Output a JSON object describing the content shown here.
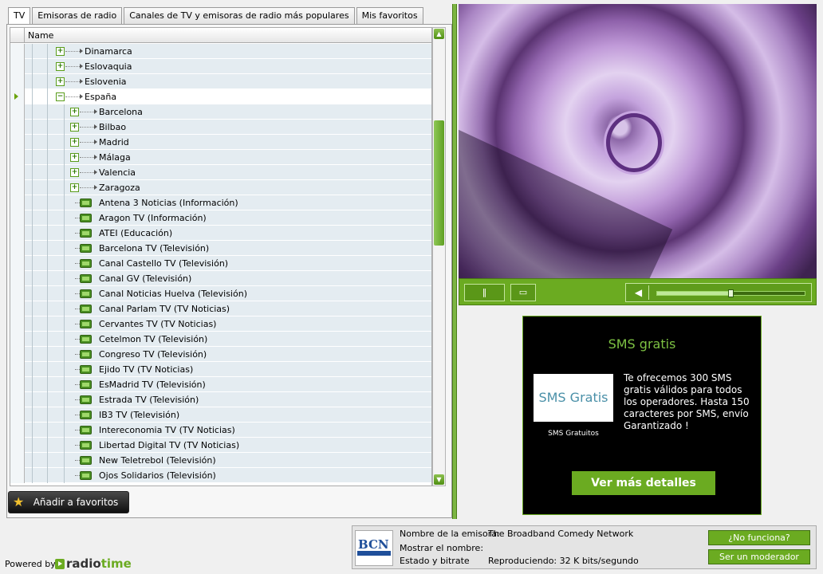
{
  "tabs": [
    {
      "label": "TV",
      "active": true
    },
    {
      "label": "Emisoras de radio",
      "active": false
    },
    {
      "label": "Canales de TV y emisoras de radio más populares",
      "active": false
    },
    {
      "label": "Mis favoritos",
      "active": false
    }
  ],
  "tree": {
    "column_header": "Name",
    "rows": [
      {
        "label": "Dinamarca",
        "level": 1,
        "type": "folder",
        "expanded": false
      },
      {
        "label": "Eslovaquia",
        "level": 1,
        "type": "folder",
        "expanded": false
      },
      {
        "label": "Eslovenia",
        "level": 1,
        "type": "folder",
        "expanded": false
      },
      {
        "label": "España",
        "level": 1,
        "type": "folder",
        "expanded": true,
        "selected": true
      },
      {
        "label": "Barcelona",
        "level": 2,
        "type": "folder",
        "expanded": false
      },
      {
        "label": "Bilbao",
        "level": 2,
        "type": "folder",
        "expanded": false
      },
      {
        "label": "Madrid",
        "level": 2,
        "type": "folder",
        "expanded": false
      },
      {
        "label": "Málaga",
        "level": 2,
        "type": "folder",
        "expanded": false
      },
      {
        "label": "Valencia",
        "level": 2,
        "type": "folder",
        "expanded": false
      },
      {
        "label": "Zaragoza",
        "level": 2,
        "type": "folder",
        "expanded": false
      },
      {
        "label": "Antena 3 Noticias (Información)",
        "level": 2,
        "type": "channel"
      },
      {
        "label": "Aragon TV (Información)",
        "level": 2,
        "type": "channel"
      },
      {
        "label": "ATEI (Educación)",
        "level": 2,
        "type": "channel"
      },
      {
        "label": "Barcelona TV (Televisión)",
        "level": 2,
        "type": "channel"
      },
      {
        "label": "Canal Castello TV (Televisión)",
        "level": 2,
        "type": "channel"
      },
      {
        "label": "Canal GV (Televisión)",
        "level": 2,
        "type": "channel"
      },
      {
        "label": "Canal Noticias Huelva (Televisión)",
        "level": 2,
        "type": "channel"
      },
      {
        "label": "Canal Parlam TV (TV Noticias)",
        "level": 2,
        "type": "channel"
      },
      {
        "label": "Cervantes TV (TV Noticias)",
        "level": 2,
        "type": "channel"
      },
      {
        "label": "Cetelmon TV (Televisión)",
        "level": 2,
        "type": "channel"
      },
      {
        "label": "Congreso TV (Televisión)",
        "level": 2,
        "type": "channel"
      },
      {
        "label": "Ejido TV (TV Noticias)",
        "level": 2,
        "type": "channel"
      },
      {
        "label": "EsMadrid TV (Televisión)",
        "level": 2,
        "type": "channel"
      },
      {
        "label": "Estrada TV (Televisión)",
        "level": 2,
        "type": "channel"
      },
      {
        "label": "IB3 TV (Televisión)",
        "level": 2,
        "type": "channel"
      },
      {
        "label": "Intereconomia TV (TV Noticias)",
        "level": 2,
        "type": "channel"
      },
      {
        "label": "Libertad Digital TV (TV Noticias)",
        "level": 2,
        "type": "channel"
      },
      {
        "label": "New Teletrebol (Televisión)",
        "level": 2,
        "type": "channel"
      },
      {
        "label": "Ojos Solidarios (Televisión)",
        "level": 2,
        "type": "channel"
      }
    ]
  },
  "favorites_button": {
    "label": "Añadir a favoritos",
    "icon": "star-icon"
  },
  "player": {
    "pause_icon": "pause-icon",
    "fullscreen_icon": "fullscreen-icon",
    "volume_icon": "speaker-icon",
    "volume_level": 0.5
  },
  "ad": {
    "title": "SMS gratis",
    "logo_text": "SMS Gratis",
    "logo_caption": "SMS Gratuitos",
    "body": "Te ofrecemos 300 SMS gratis válidos para todos los operadores. Hasta 150 caracteres por SMS, envío Garantizado !",
    "button_label": "Ver más detalles"
  },
  "station_info": {
    "logo_text": "BCN",
    "station_name_label": "Nombre de la emisora:",
    "station_name_value": "The Broadband Comedy Network",
    "show_name_label": "Mostrar el nombre:",
    "status_label": "Estado y bitrate",
    "status_value": "Reproduciendo: 32 K bits/segundo",
    "not_working_button": "¿No funciona?",
    "moderator_button": "Ser un moderador"
  },
  "footer": {
    "powered_by": "Powered by",
    "logo_part1": "radio",
    "logo_part2": "time"
  },
  "colors": {
    "accent_green": "#6bab21",
    "row_blue": "#e4ecf1",
    "ad_background": "#000000"
  }
}
